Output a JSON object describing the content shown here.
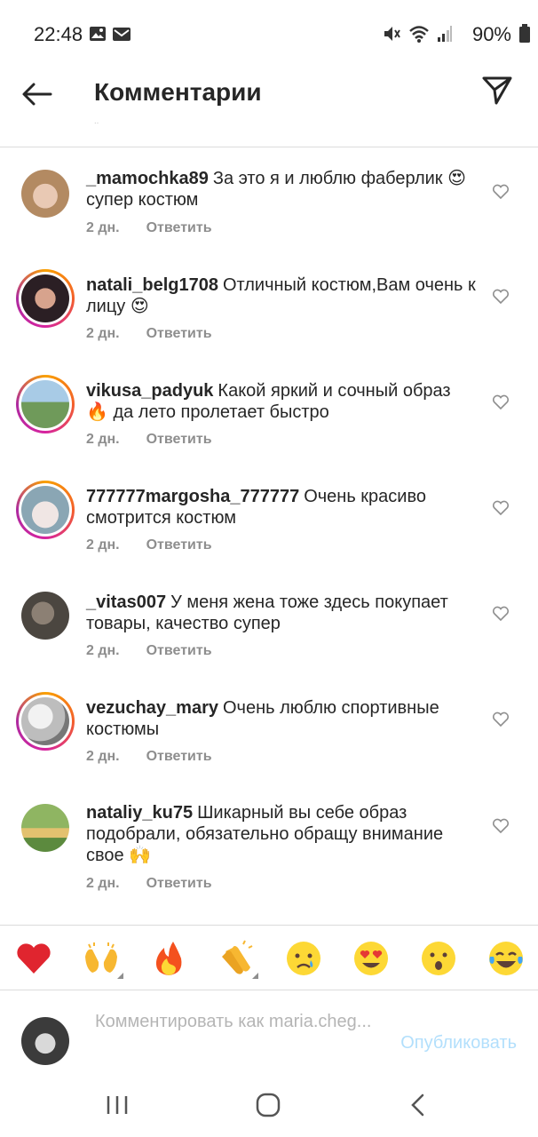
{
  "status": {
    "time": "22:48",
    "battery": "90%"
  },
  "header": {
    "title": "Комментарии"
  },
  "comments": [
    {
      "username": "_mamochka89",
      "text": "За это я и  люблю фаберлик 😍 супер костюм",
      "age": "2 дн.",
      "reply": "Ответить"
    },
    {
      "username": "natali_belg1708",
      "text": "Отличный костюм,Вам очень к лицу 😍",
      "age": "2 дн.",
      "reply": "Ответить"
    },
    {
      "username": "vikusa_padyuk",
      "text": "Какой яркий и сочный образ 🔥 да лето пролетает быстро",
      "age": "2 дн.",
      "reply": "Ответить"
    },
    {
      "username": "777777margosha_777777",
      "text": "Очень красиво смотрится костюм",
      "age": "2 дн.",
      "reply": "Ответить"
    },
    {
      "username": "_vitas007",
      "text": "У меня жена тоже здесь покупает товары, качество супер",
      "age": "2 дн.",
      "reply": "Ответить"
    },
    {
      "username": "vezuchay_mary",
      "text": "Очень люблю спортивные костюмы",
      "age": "2 дн.",
      "reply": "Ответить"
    },
    {
      "username": "nataliy_ku75",
      "text": "Шикарный вы себе образ подобрали, обязательно обращу внимание свое 🙌",
      "age": "2 дн.",
      "reply": "Ответить"
    }
  ],
  "composer": {
    "placeholder": "Комментировать как maria.cheg...",
    "publish": "Опубликовать"
  },
  "colors": {
    "accent_disabled": "#b2dffc",
    "secondary_text": "#8e8e8e"
  }
}
